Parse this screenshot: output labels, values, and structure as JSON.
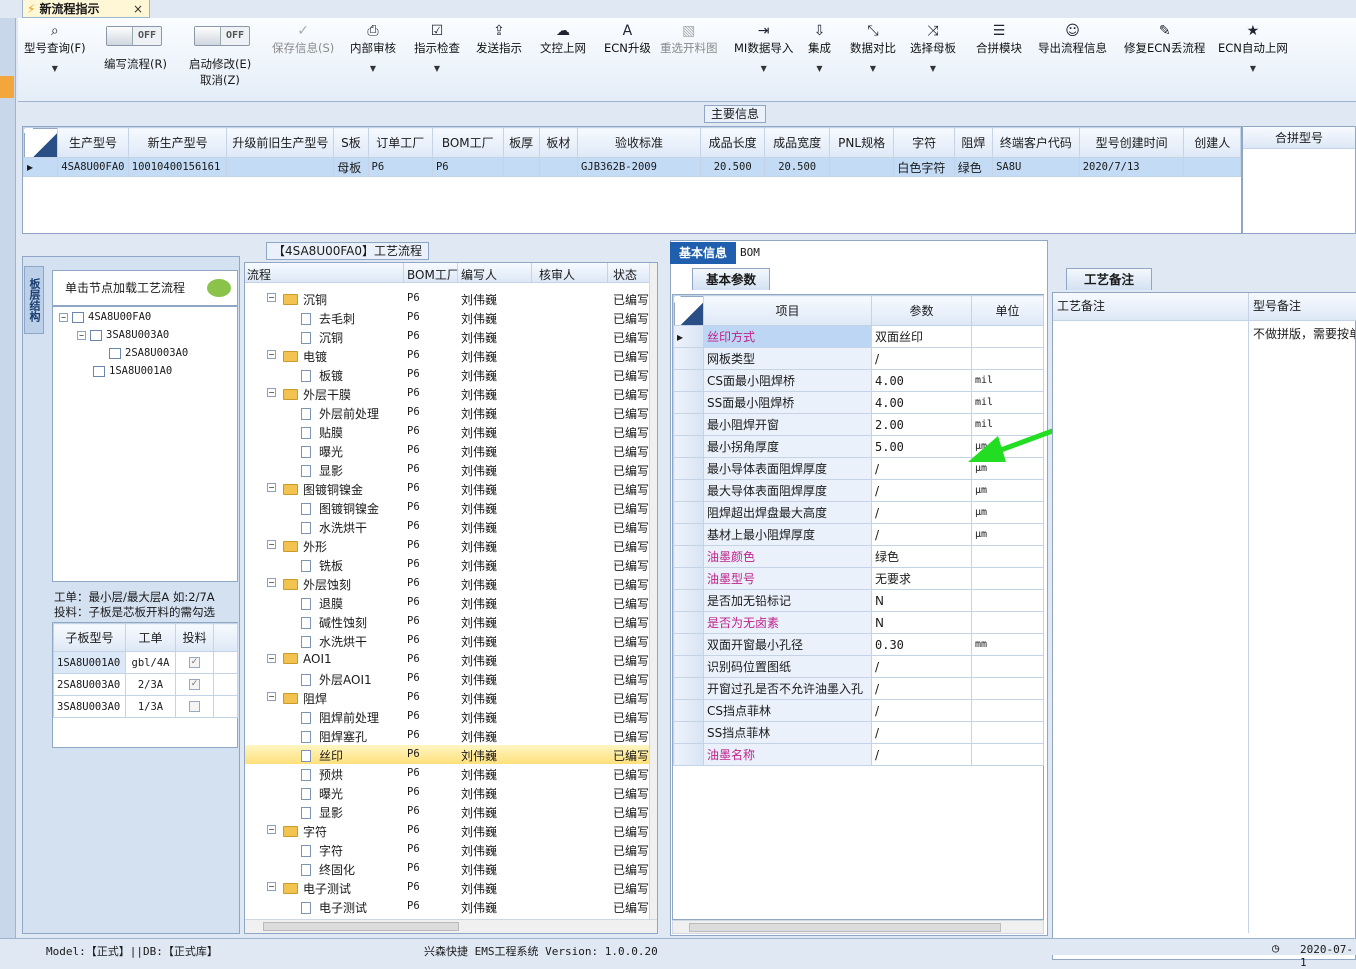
{
  "tab": {
    "title": "新流程指示"
  },
  "toolbar": {
    "items": [
      {
        "label": "型号查询(F)",
        "icon": "⌕"
      },
      {
        "label": "保存信息(S)",
        "icon": "✓"
      },
      {
        "label": "内部审核",
        "icon": "⎙"
      },
      {
        "label": "指示检查",
        "icon": "☑"
      },
      {
        "label": "发送指示",
        "icon": "⇪"
      },
      {
        "label": "文控上网",
        "icon": "☁"
      },
      {
        "label": "ECN升级",
        "icon": "A"
      },
      {
        "label": "重选开料图",
        "icon": "▧"
      },
      {
        "label": "MI数据导入",
        "icon": "⇥"
      },
      {
        "label": "集成",
        "icon": "⇩"
      },
      {
        "label": "数据对比",
        "icon": "⤡"
      },
      {
        "label": "选择母板",
        "icon": "⤨"
      },
      {
        "label": "合拼模块",
        "icon": "☰"
      },
      {
        "label": "导出流程信息",
        "icon": "☺"
      },
      {
        "label": "修复ECN丢流程",
        "icon": "✎"
      },
      {
        "label": "ECN自动上网",
        "icon": "★"
      }
    ],
    "toggle1": {
      "state": "OFF",
      "label": "编写流程(R)"
    },
    "toggle2": {
      "state": "OFF",
      "label": "启动修改(E)",
      "sub": "取消(Z)"
    }
  },
  "main_info": {
    "title": "主要信息",
    "columns": [
      "生产型号",
      "新生产型号",
      "升级前旧生产型号",
      "S板",
      "订单工厂",
      "BOM工厂",
      "板厚",
      "板材",
      "验收标准",
      "成品长度",
      "成品宽度",
      "PNL规格",
      "字符",
      "阻焊",
      "终端客户代码",
      "型号创建时间",
      "创建人"
    ],
    "row": [
      "4SA8U00FA0",
      "10010400156161",
      "",
      "母板",
      "P6",
      "P6",
      "",
      "",
      "GJB362B-2009",
      "20.500",
      "20.500",
      "",
      "白色字符",
      "绿色",
      "SA8U",
      "2020/7/13",
      ""
    ],
    "merge_col": "合拼型号"
  },
  "structure": {
    "vtab": "板层结构",
    "hint": "单击节点加载工艺流程",
    "nodes": [
      "4SA8U00FA0",
      "3SA8U003A0",
      "2SA8U003A0",
      "1SA8U001A0"
    ],
    "note1": "工单：最小层/最大层A 如:2/7A",
    "note2": "投料：子板是芯板开料的需勾选",
    "sub_columns": [
      "子板型号",
      "工单",
      "投料"
    ],
    "sub_rows": [
      {
        "model": "1SA8U001A0",
        "order": "gbl/4A",
        "feed": "✓"
      },
      {
        "model": "2SA8U003A0",
        "order": "2/3A",
        "feed": "✓"
      },
      {
        "model": "3SA8U003A0",
        "order": "1/3A",
        "feed": ""
      }
    ]
  },
  "process": {
    "title": "【4SA8U00FA0】工艺流程",
    "columns": [
      "流程",
      "BOM工厂",
      "编写人",
      "核审人",
      "状态"
    ],
    "factory": "P6",
    "writer": "刘伟巍",
    "status": "已编写",
    "rows": [
      {
        "name": "沉铜",
        "group": true
      },
      {
        "name": "去毛刺",
        "group": false
      },
      {
        "name": "沉铜",
        "group": false
      },
      {
        "name": "电镀",
        "group": true
      },
      {
        "name": "板镀",
        "group": false
      },
      {
        "name": "外层干膜",
        "group": true
      },
      {
        "name": "外层前处理",
        "group": false
      },
      {
        "name": "贴膜",
        "group": false
      },
      {
        "name": "曝光",
        "group": false
      },
      {
        "name": "显影",
        "group": false
      },
      {
        "name": "图镀铜镍金",
        "group": true
      },
      {
        "name": "图镀铜镍金",
        "group": false
      },
      {
        "name": "水洗烘干",
        "group": false
      },
      {
        "name": "外形",
        "group": true
      },
      {
        "name": "铣板",
        "group": false
      },
      {
        "name": "外层蚀刻",
        "group": true
      },
      {
        "name": "退膜",
        "group": false
      },
      {
        "name": "碱性蚀刻",
        "group": false
      },
      {
        "name": "水洗烘干",
        "group": false
      },
      {
        "name": "AOI1",
        "group": true
      },
      {
        "name": "外层AOI1",
        "group": false
      },
      {
        "name": "阻焊",
        "group": true
      },
      {
        "name": "阻焊前处理",
        "group": false
      },
      {
        "name": "阻焊塞孔",
        "group": false
      },
      {
        "name": "丝印",
        "group": false,
        "selected": true
      },
      {
        "name": "预烘",
        "group": false
      },
      {
        "name": "曝光",
        "group": false
      },
      {
        "name": "显影",
        "group": false
      },
      {
        "name": "字符",
        "group": true
      },
      {
        "name": "字符",
        "group": false
      },
      {
        "name": "终固化",
        "group": false
      },
      {
        "name": "电子测试",
        "group": true
      },
      {
        "name": "电子测试",
        "group": false
      }
    ]
  },
  "basic": {
    "tab_info": "基本信息",
    "tab_bom": "BOM",
    "subtab": "基本参数",
    "columns": [
      "项目",
      "参数",
      "单位"
    ],
    "rows": [
      {
        "item": "丝印方式",
        "value": "双面丝印",
        "unit": "",
        "hi": true
      },
      {
        "item": "网板类型",
        "value": "/",
        "unit": ""
      },
      {
        "item": "CS面最小阻焊桥",
        "value": "4.00",
        "unit": "mil"
      },
      {
        "item": "SS面最小阻焊桥",
        "value": "4.00",
        "unit": "mil"
      },
      {
        "item": "最小阻焊开窗",
        "value": "2.00",
        "unit": "mil"
      },
      {
        "item": "最小拐角厚度",
        "value": "5.00",
        "unit": "μm"
      },
      {
        "item": "最小导体表面阻焊厚度",
        "value": "/",
        "unit": "μm"
      },
      {
        "item": "最大导体表面阻焊厚度",
        "value": "/",
        "unit": "μm"
      },
      {
        "item": "阻焊超出焊盘最大高度",
        "value": "/",
        "unit": "μm"
      },
      {
        "item": "基材上最小阻焊厚度",
        "value": "/",
        "unit": "μm"
      },
      {
        "item": "油墨颜色",
        "value": "绿色",
        "unit": "",
        "hi": true
      },
      {
        "item": "油墨型号",
        "value": "无要求",
        "unit": "",
        "hi": true
      },
      {
        "item": "是否加无铅标记",
        "value": "N",
        "unit": ""
      },
      {
        "item": "是否为无卤素",
        "value": "N",
        "unit": "",
        "hi": true
      },
      {
        "item": "双面开窗最小孔径",
        "value": "0.30",
        "unit": "mm"
      },
      {
        "item": "识别码位置图纸",
        "value": "/",
        "unit": ""
      },
      {
        "item": "开窗过孔是否不允许油墨入孔",
        "value": "/",
        "unit": ""
      },
      {
        "item": "CS挡点菲林",
        "value": "/",
        "unit": ""
      },
      {
        "item": "SS挡点菲林",
        "value": "/",
        "unit": ""
      },
      {
        "item": "油墨名称",
        "value": "/",
        "unit": "",
        "hi": true
      }
    ]
  },
  "remarks": {
    "tab": "工艺备注",
    "col1": "工艺备注",
    "col2": "型号备注",
    "text": "不做拼版，需要按单"
  },
  "status": {
    "left": "Model:【正式】||DB:【正式库】",
    "center": "兴森快捷 EMS工程系统 Version: 1.0.0.20",
    "right": "2020-07-1"
  },
  "colors": {
    "accent": "#1f5fae",
    "highlight": "#c0218a",
    "arrow": "#22dd22"
  }
}
